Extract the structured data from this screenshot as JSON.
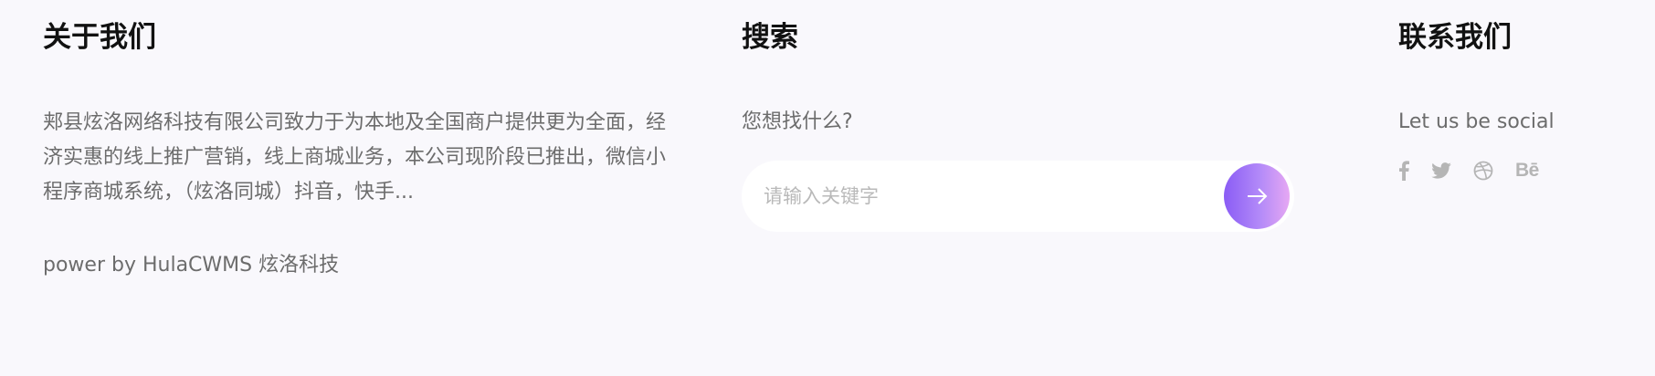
{
  "about": {
    "heading": "关于我们",
    "description": "郏县炫洛网络科技有限公司致力于为本地及全国商户提供更为全面，经济实惠的线上推广营销，线上商城业务，本公司现阶段已推出，微信小程序商城系统，（炫洛同城）抖音，快手...",
    "power_by": "power by HulaCWMS 炫洛科技"
  },
  "search": {
    "heading": "搜索",
    "prompt": "您想找什么?",
    "placeholder": "请输入关键字",
    "button_icon": "arrow-right-icon"
  },
  "contact": {
    "heading": "联系我们",
    "social_title": "Let us be social",
    "social_icons": [
      "facebook-icon",
      "twitter-icon",
      "dribbble-icon",
      "behance-icon"
    ],
    "behance_label": "Bē"
  },
  "colors": {
    "background": "#f9f8fc",
    "accent_start": "#8a5cf5",
    "accent_end": "#e6a8f3",
    "muted_text": "#6c6c6c",
    "icon_gray": "#b5b5b5"
  }
}
